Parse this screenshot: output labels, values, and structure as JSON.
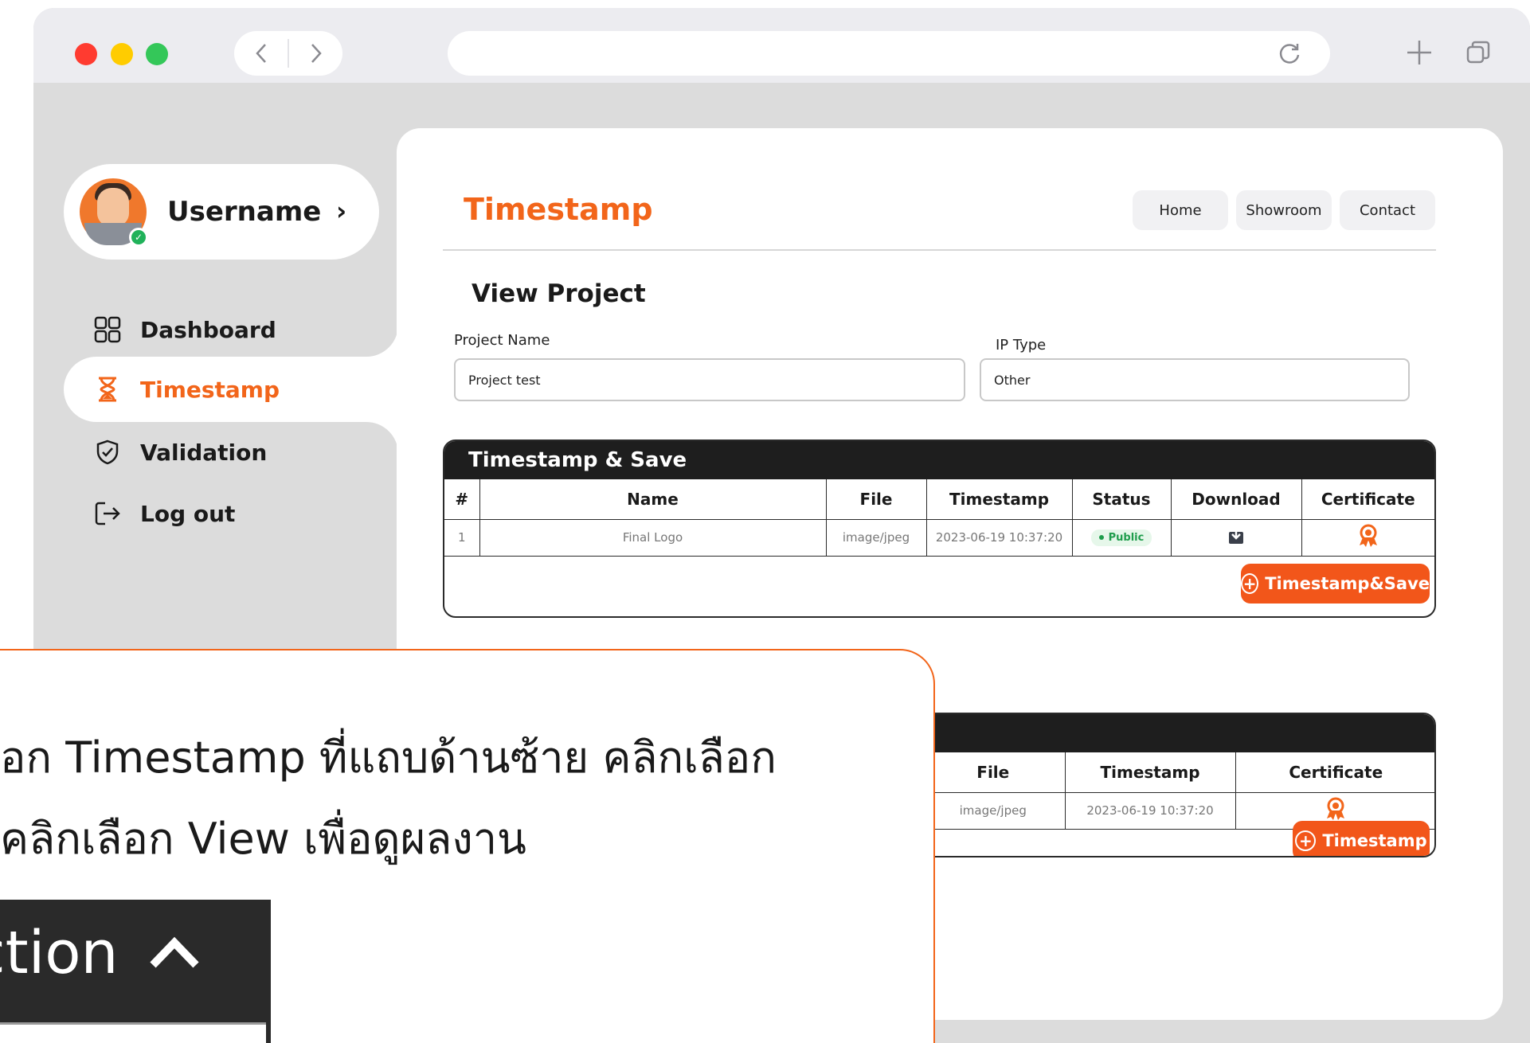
{
  "browser": {
    "window_controls": [
      "close",
      "minimize",
      "zoom"
    ],
    "nav_icons": [
      "chevron-left-icon",
      "chevron-right-icon"
    ],
    "toolbar_icons": [
      "reload-icon",
      "plus-icon",
      "tabs-icon"
    ]
  },
  "sidebar": {
    "username": "Username",
    "items": [
      {
        "label": "Dashboard",
        "icon": "dashboard-icon"
      },
      {
        "label": "Timestamp",
        "icon": "hourglass-icon",
        "active": true
      },
      {
        "label": "Validation",
        "icon": "shield-check-icon"
      },
      {
        "label": "Log out",
        "icon": "logout-icon"
      }
    ]
  },
  "header": {
    "brand": "Timestamp",
    "nav": [
      "Home",
      "Showroom",
      "Contact"
    ]
  },
  "project": {
    "title": "View Project",
    "name_label": "Project Name",
    "name_value": "Project test",
    "iptype_label": "IP Type",
    "iptype_value": "Other"
  },
  "timestamp_save": {
    "title": "Timestamp & Save",
    "columns": [
      "#",
      "Name",
      "File",
      "Timestamp",
      "Status",
      "Download",
      "Certificate"
    ],
    "rows": [
      {
        "num": "1",
        "name": "Final Logo",
        "file": "image/jpeg",
        "timestamp": "2023-06-19 10:37:20",
        "status": "Public"
      }
    ],
    "button": "Timestamp&Save"
  },
  "timestamp_table": {
    "columns": [
      "File",
      "Timestamp",
      "Certificate"
    ],
    "rows": [
      {
        "file": "image/jpeg",
        "timestamp": "2023-06-19 10:37:20"
      }
    ],
    "button": "Timestamp"
  },
  "callout": {
    "line1": "อก Timestamp ที่แถบด้านซ้าย คลิกเลือก",
    "line2": "คลิกเลือก View เพื่อดูผลงาน",
    "chip_label": "ction"
  },
  "colors": {
    "accent": "#f2651a",
    "dark": "#1e1e1e",
    "status_public": "#1f9d4c"
  }
}
